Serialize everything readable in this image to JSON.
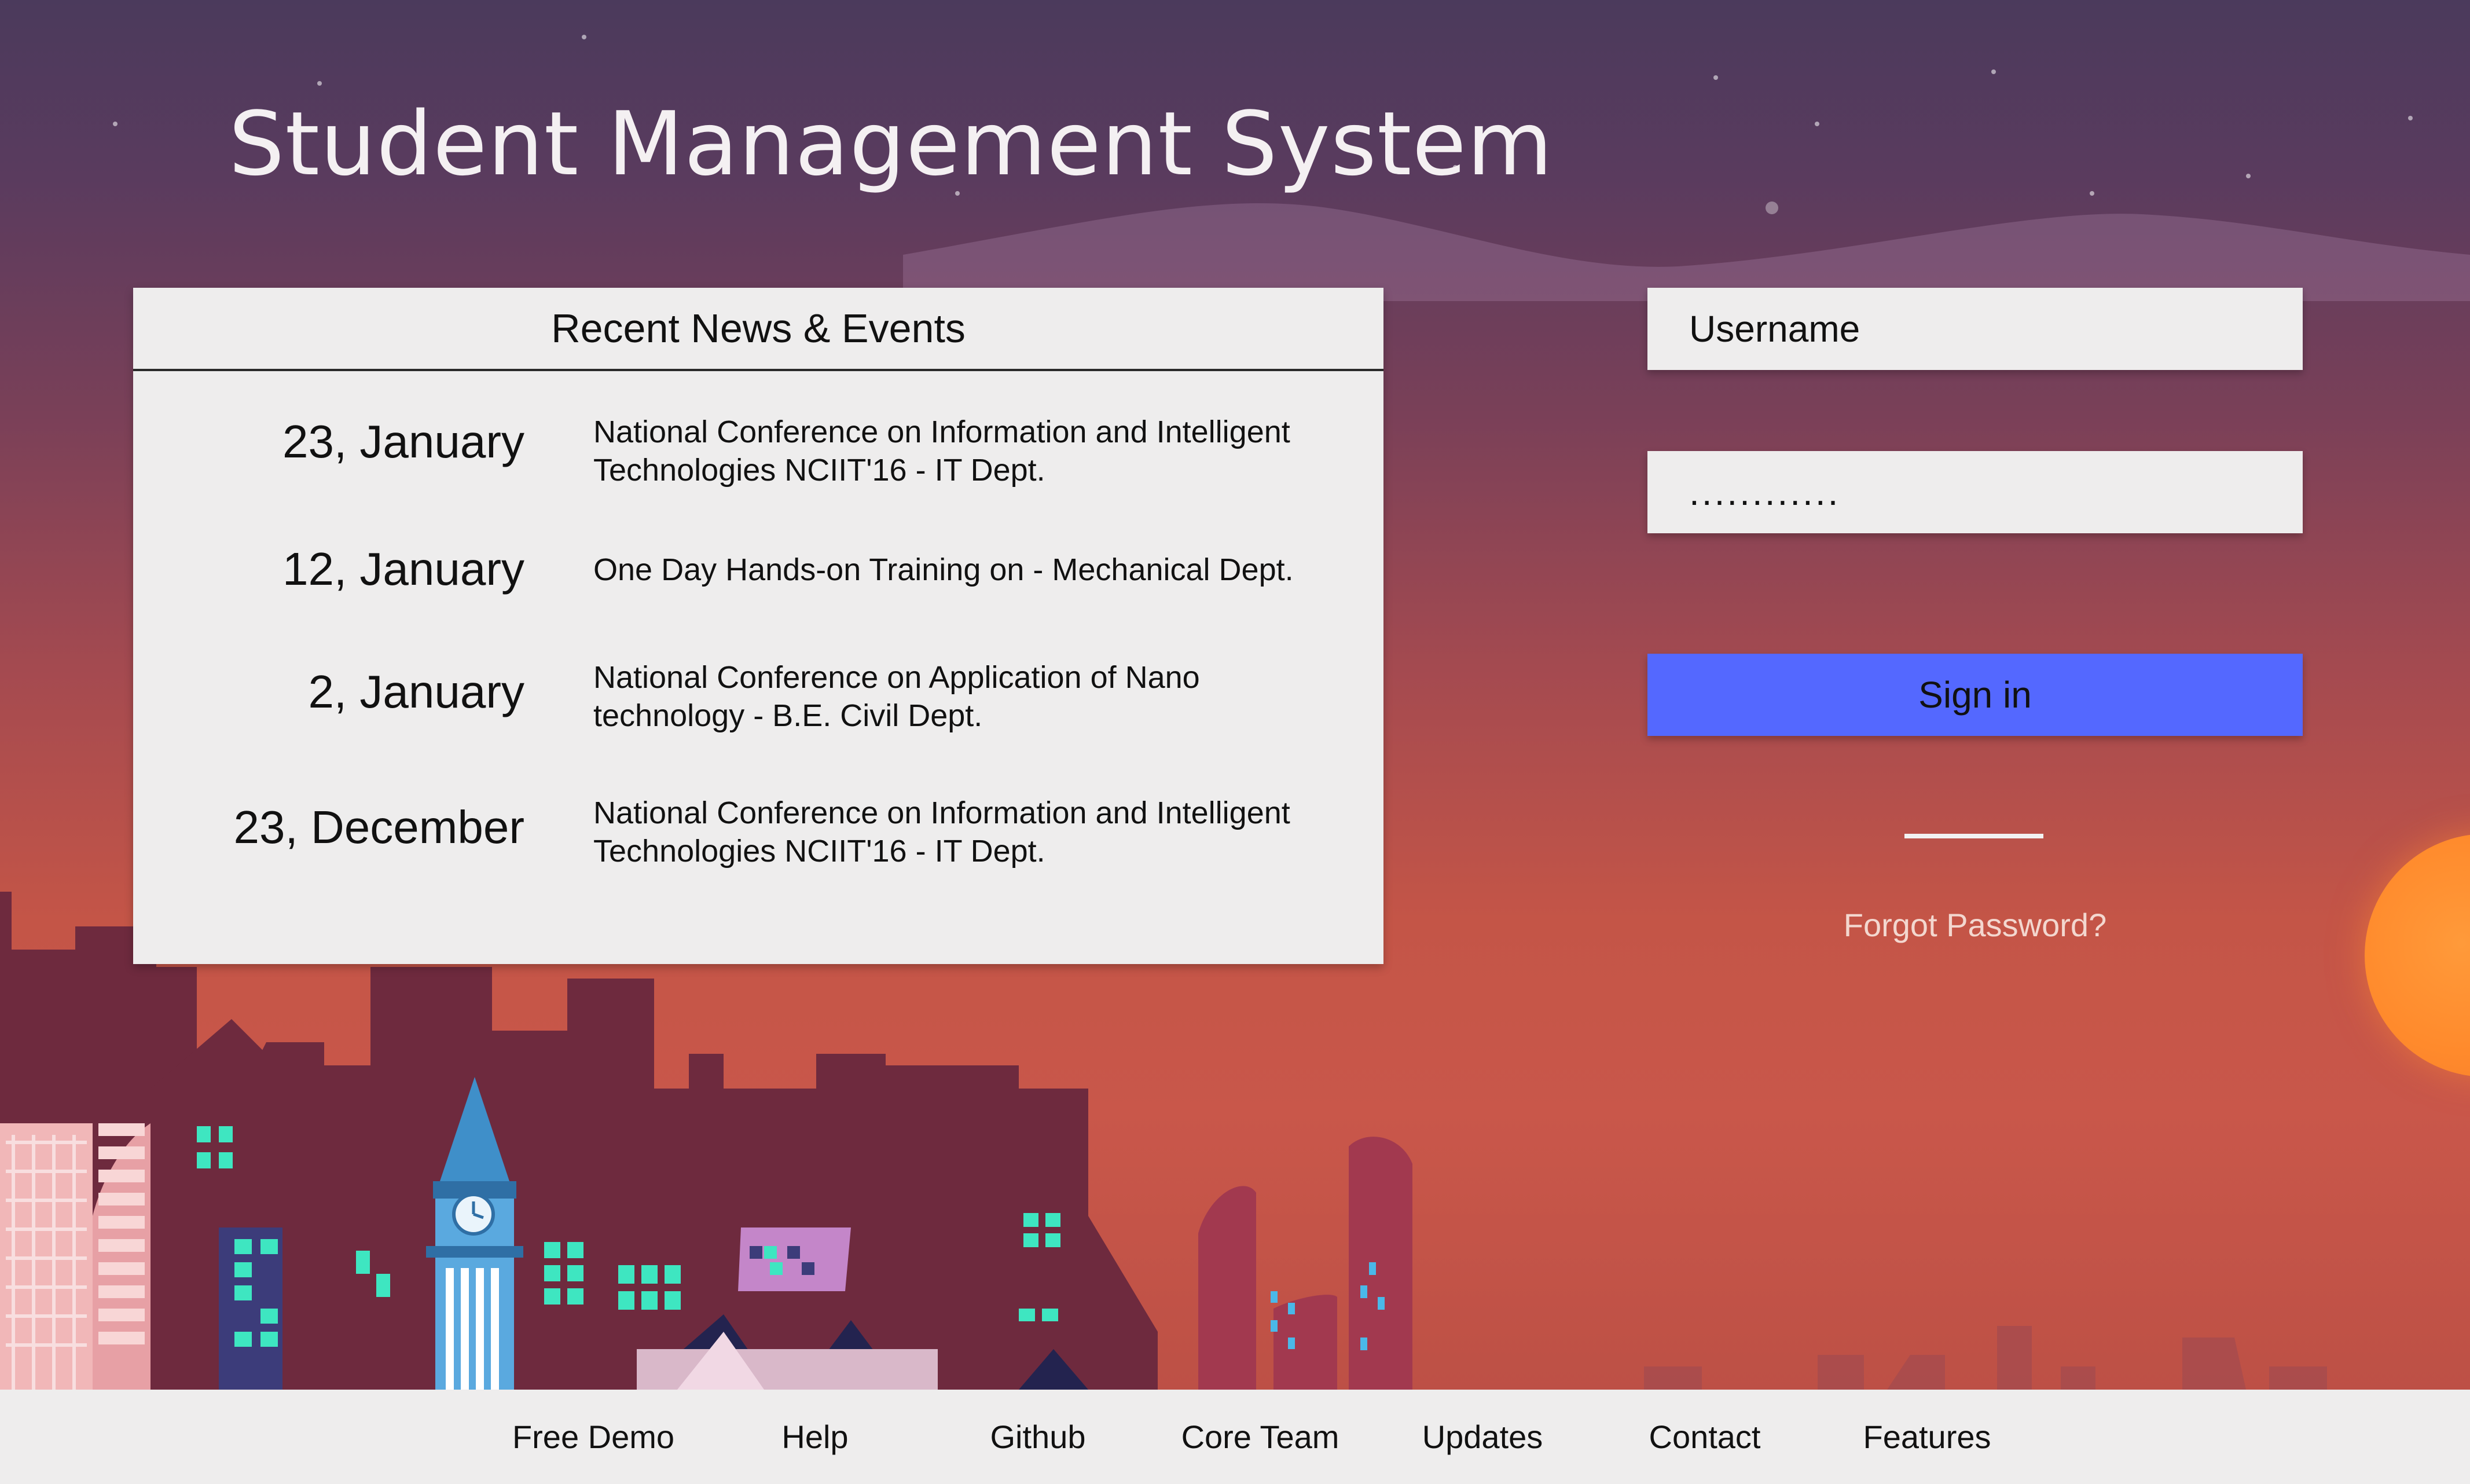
{
  "app_title": "Student Management System",
  "news": {
    "heading": "Recent News & Events",
    "items": [
      {
        "date": "23, January",
        "text": "National Conference on Information and Intelligent Technologies NCIIT'16 - IT Dept."
      },
      {
        "date": "12, January",
        "text": "One Day Hands-on Training on  - Mechanical Dept."
      },
      {
        "date": "2, January",
        "text": "National Conference on Application of Nano technology - B.E. Civil Dept."
      },
      {
        "date": "23, December",
        "text": "National Conference on Information and Intelligent Technologies NCIIT'16 - IT Dept."
      }
    ]
  },
  "login": {
    "username_placeholder": "Username",
    "password_value": "............",
    "signin_label": "Sign in",
    "forgot_label": "Forgot Password?"
  },
  "footer": {
    "links": [
      "Free Demo",
      "Help",
      "Github",
      "Core Team",
      "Updates",
      "Contact",
      "Features"
    ]
  },
  "colors": {
    "signin_button": "#5468ff",
    "panel_bg": "#eeeded",
    "sun": "#ff8a2c"
  }
}
